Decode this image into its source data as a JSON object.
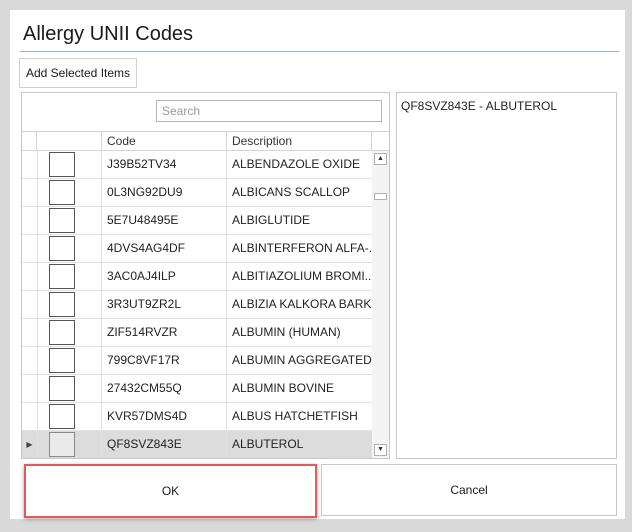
{
  "dialog": {
    "title": "Allergy UNII Codes",
    "add_selected_label": "Add Selected Items",
    "ok_label": "OK",
    "cancel_label": "Cancel"
  },
  "search": {
    "placeholder": "Search",
    "value": ""
  },
  "columns": {
    "code": "Code",
    "description": "Description"
  },
  "rows": [
    {
      "code": "J39B52TV34",
      "description": "ALBENDAZOLE OXIDE",
      "checked": false
    },
    {
      "code": "0L3NG92DU9",
      "description": "ALBICANS SCALLOP",
      "checked": false
    },
    {
      "code": "5E7U48495E",
      "description": "ALBIGLUTIDE",
      "checked": false
    },
    {
      "code": "4DVS4AG4DF",
      "description": "ALBINTERFERON ALFA-...",
      "checked": false
    },
    {
      "code": "3AC0AJ4ILP",
      "description": "ALBITIAZOLIUM BROMI...",
      "checked": false
    },
    {
      "code": "3R3UT9ZR2L",
      "description": "ALBIZIA KALKORA BARK",
      "checked": false
    },
    {
      "code": "ZIF514RVZR",
      "description": "ALBUMIN (HUMAN)",
      "checked": false
    },
    {
      "code": "799C8VF17R",
      "description": "ALBUMIN AGGREGATED",
      "checked": false
    },
    {
      "code": "27432CM55Q",
      "description": "ALBUMIN BOVINE",
      "checked": false
    },
    {
      "code": "KVR57DMS4D",
      "description": "ALBUS HATCHETFISH",
      "checked": false
    },
    {
      "code": "QF8SVZ843E",
      "description": "ALBUTEROL",
      "checked": false,
      "selected": true
    }
  ],
  "selected_items": [
    "QF8SVZ843E - ALBUTEROL"
  ],
  "icons": {
    "row_indicator": "triangle-right-icon",
    "scroll_up": "triangle-up-icon",
    "scroll_down": "triangle-down-icon"
  }
}
